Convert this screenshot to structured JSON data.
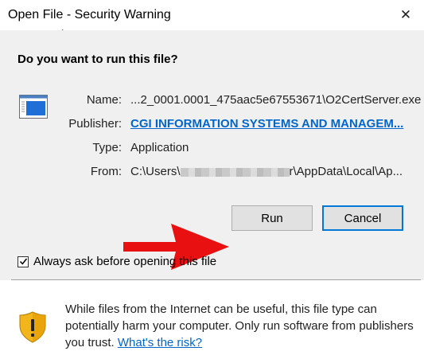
{
  "window": {
    "title": "Open File - Security Warning",
    "close_glyph": "✕"
  },
  "dialog": {
    "question": "Do you want to run this file?",
    "labels": {
      "name": "Name:",
      "publisher": "Publisher:",
      "type": "Type:",
      "from": "From:"
    },
    "values": {
      "name": "...2_0001.0001_475aac5e67553671\\O2CertServer.exe",
      "publisher": "CGI INFORMATION SYSTEMS AND MANAGEM...",
      "type": "Application",
      "from_prefix": "C:\\Users\\",
      "from_suffix": "r\\AppData\\Local\\Ap..."
    },
    "buttons": {
      "run": "Run",
      "cancel": "Cancel"
    },
    "checkbox": {
      "label": "Always ask before opening this file",
      "checked": true
    }
  },
  "footer": {
    "warning": "While files from the Internet can be useful, this file type can potentially harm your computer. Only run software from publishers you trust.",
    "link": "What's the risk?"
  },
  "icons": [
    "close-icon",
    "mouse-cursor-icon",
    "application-file-icon",
    "red-arrow-icon",
    "checkmark-icon",
    "warning-shield-icon"
  ],
  "colors": {
    "link": "#0066cc",
    "focus_border": "#0078d7",
    "arrow": "#e81010"
  }
}
